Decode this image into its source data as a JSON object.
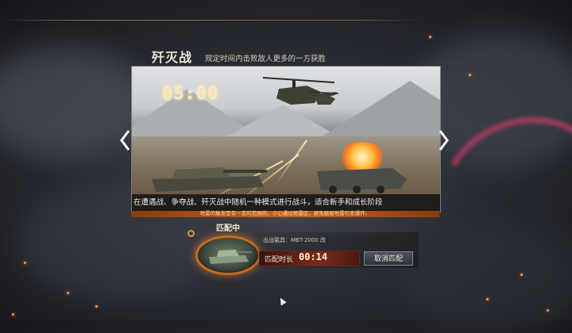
{
  "mode": {
    "title": "歼灭战",
    "description": "规定时间内击败敌人更多的一方获胜"
  },
  "banner": {
    "timer": "05:00",
    "caption": "在遭遇战、争夺战、歼灭战中随机一种模式进行战斗，适合新手和成长阶段",
    "tip": "地雷的触发是有一定的范围的，小心通过地雷区，避免触碰地雷引发爆炸。"
  },
  "matchmaking": {
    "status_label": "匹配中",
    "vehicle_label": "出战载具：MBT-2000 改",
    "time_label": "匹配时长",
    "time_value": "00:14",
    "cancel_label": "取消匹配"
  },
  "colors": {
    "accent": "#c86b1c",
    "timer_glow": "#ffdd99",
    "panel_red": "#7a2a1a"
  }
}
